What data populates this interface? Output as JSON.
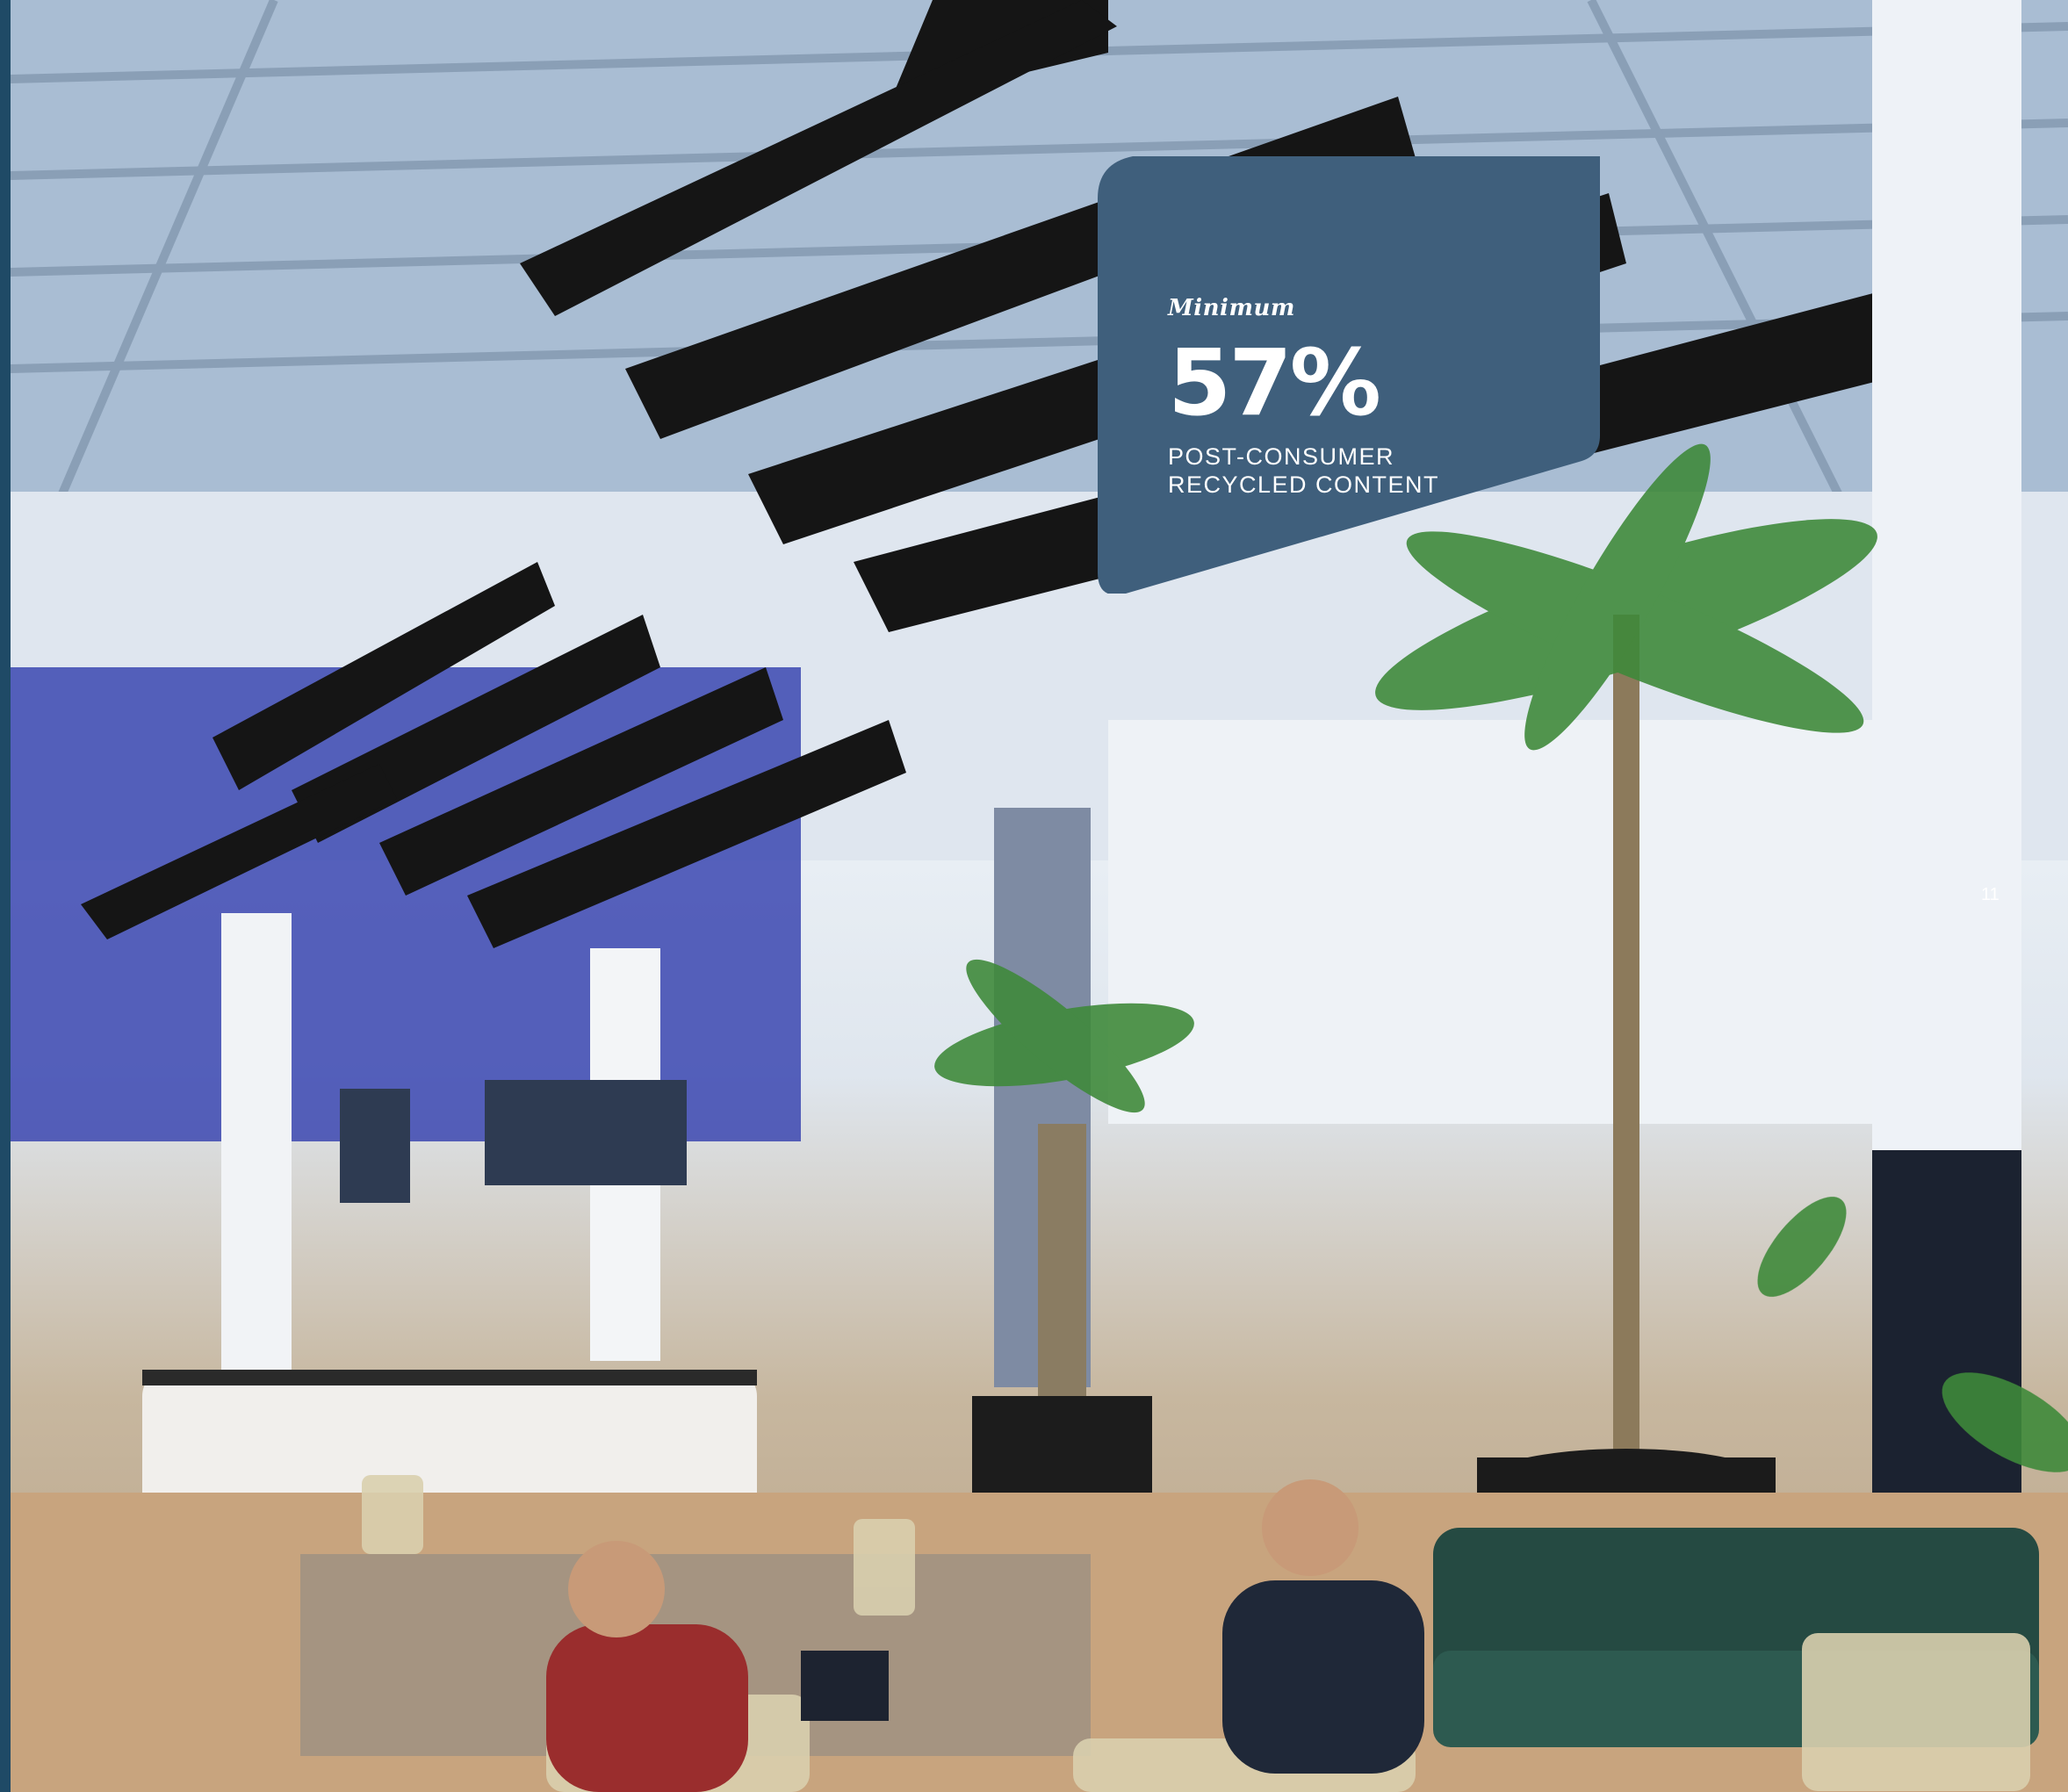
{
  "stat": {
    "label": "Minimum",
    "value": "57%",
    "line1": "POST-CONSUMER",
    "line2": "RECYCLED CONTENT"
  },
  "page": {
    "number": "11"
  },
  "colors": {
    "card_fill": "#3f5f7c",
    "accent_outline": "#f2b51e",
    "left_edge": "#1f4a66"
  },
  "icons": {
    "photo": "interior-photo-with-hanging-acoustic-baffles"
  }
}
